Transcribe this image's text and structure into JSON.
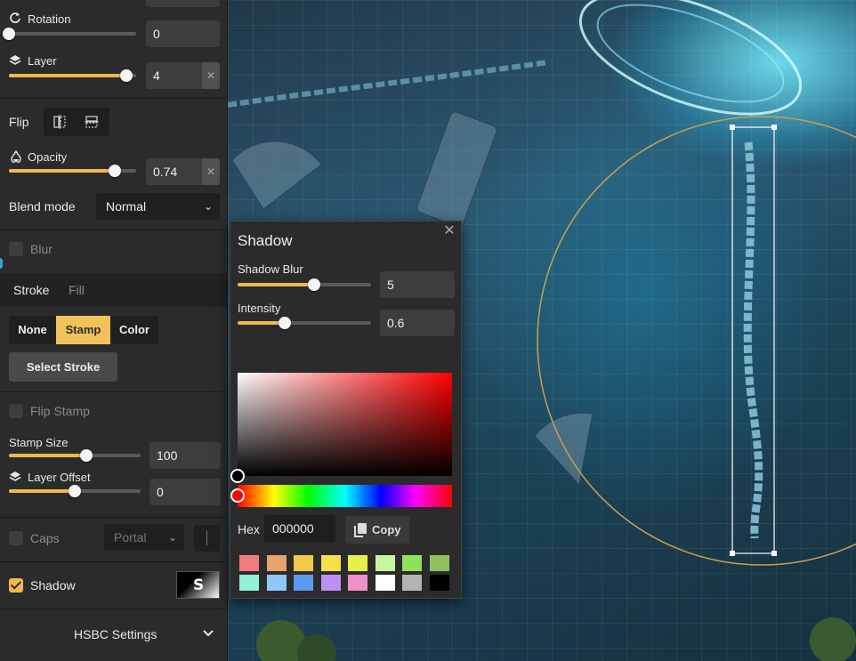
{
  "transform": {
    "rotation": {
      "label": "Rotation",
      "value": "0",
      "level": 0
    },
    "layer": {
      "label": "Layer",
      "value": "4",
      "level": 0.92
    }
  },
  "flip": {
    "label": "Flip"
  },
  "opacity": {
    "label": "Opacity",
    "value": "0.74",
    "level": 0.83
  },
  "blend": {
    "label": "Blend mode",
    "selected": "Normal"
  },
  "blur": {
    "label": "Blur",
    "checked": false
  },
  "tabs": {
    "stroke": "Stroke",
    "fill": "Fill",
    "active": "Stroke"
  },
  "stroke_mode": {
    "options": [
      "None",
      "Stamp",
      "Color"
    ],
    "active": "Stamp"
  },
  "select_stroke": "Select Stroke",
  "flip_stamp": {
    "label": "Flip Stamp",
    "checked": false
  },
  "stamp_size": {
    "label": "Stamp Size",
    "value": "100",
    "level": 0.59
  },
  "layer_offset": {
    "label": "Layer Offset",
    "value": "0",
    "level": 0.5
  },
  "caps": {
    "label": "Caps",
    "checked": false,
    "selected": "Portal"
  },
  "shadow": {
    "label": "Shadow",
    "checked": true,
    "preview_letter": "S"
  },
  "hsbc": {
    "label": "HSBC Settings"
  },
  "popup": {
    "title": "Shadow",
    "blur": {
      "label": "Shadow Blur",
      "value": "5",
      "level": 0.57
    },
    "intensity": {
      "label": "Intensity",
      "value": "0.6",
      "level": 0.35
    },
    "hex_label": "Hex",
    "hex_value": "000000",
    "copy_label": "Copy",
    "swatches": [
      "#f07b7b",
      "#e8a46a",
      "#f2c84b",
      "#f5e04a",
      "#e6f04a",
      "#c8f5a0",
      "#8fe05a",
      "#90c060",
      "#90f0d8",
      "#8ec8f5",
      "#5a9af0",
      "#c090f0",
      "#f090c8",
      "#ffffff",
      "#b4b4b4",
      "#000000"
    ]
  },
  "colors": {
    "accent": "#f2b84b",
    "panel": "#2b2b2b",
    "selection_ring": "#c8a050"
  }
}
